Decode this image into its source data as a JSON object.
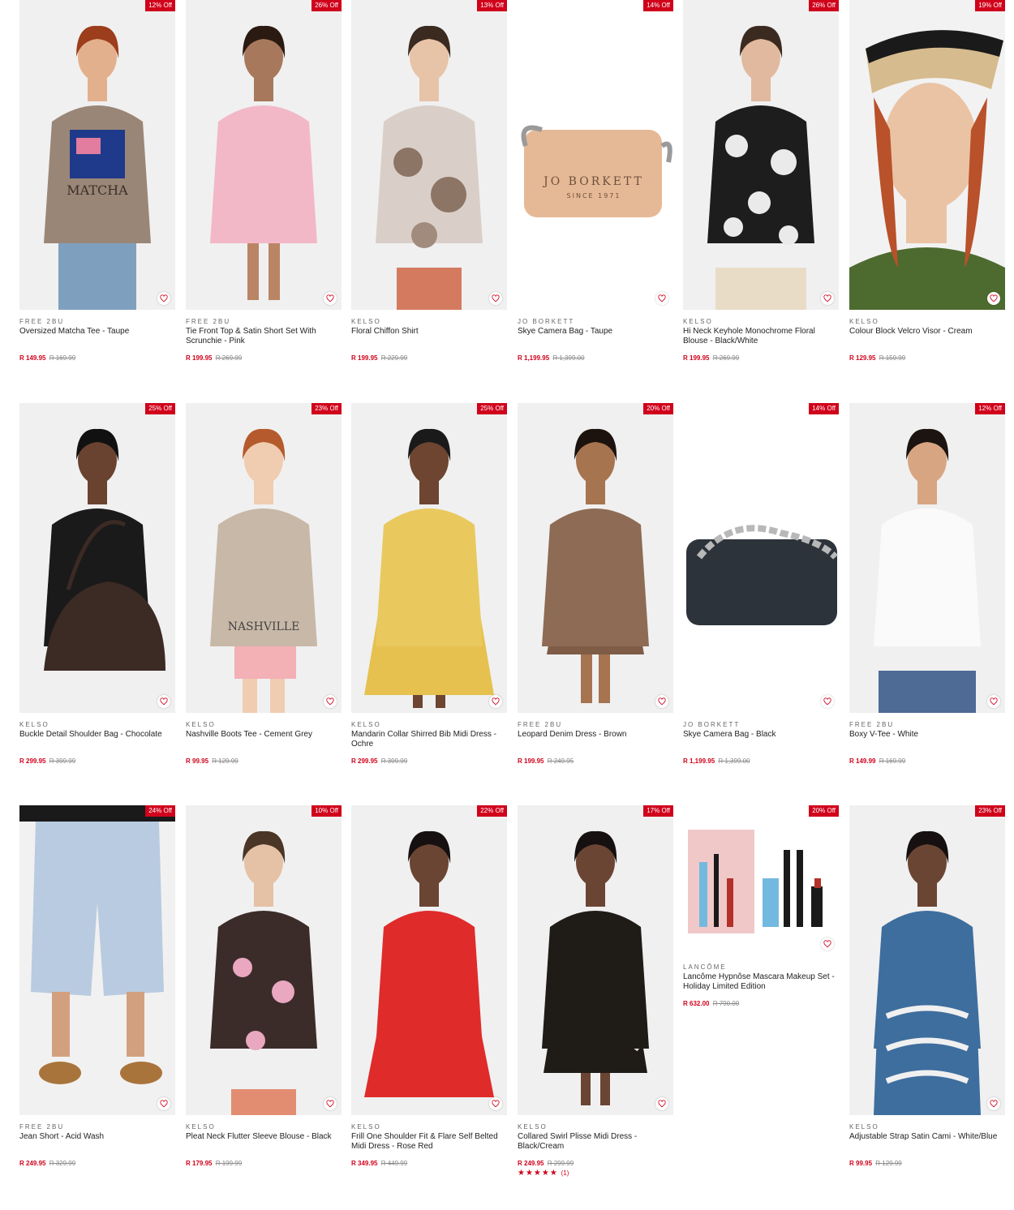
{
  "accent": "#d0021b",
  "products": [
    {
      "badge": "12% Off",
      "brand": "FREE 2BU",
      "name": "Oversized Matcha Tee - Taupe",
      "price": "R 149.95",
      "was": "R 169.99",
      "art": "matcha"
    },
    {
      "badge": "26% Off",
      "brand": "FREE 2BU",
      "name": "Tie Front Top & Satin Short Set With Scrunchie - Pink",
      "price": "R 199.95",
      "was": "R 269.99",
      "art": "pink"
    },
    {
      "badge": "13% Off",
      "brand": "KELSO",
      "name": "Floral Chiffon Shirt",
      "price": "R 199.95",
      "was": "R 229.99",
      "art": "floral"
    },
    {
      "badge": "14% Off",
      "brand": "JO BORKETT",
      "name": "Skye Camera Bag - Taupe",
      "price": "R 1,199.95",
      "was": "R 1,399.00",
      "art": "bag-taupe"
    },
    {
      "badge": "26% Off",
      "brand": "KELSO",
      "name": "Hi Neck Keyhole Monochrome Floral Blouse - Black/White",
      "price": "R 199.95",
      "was": "R 269.99",
      "art": "mono"
    },
    {
      "badge": "19% Off",
      "brand": "KELSO",
      "name": "Colour Block Velcro Visor - Cream",
      "price": "R 129.95",
      "was": "R 159.99",
      "art": "visor"
    },
    {
      "badge": "25% Off",
      "brand": "KELSO",
      "name": "Buckle Detail Shoulder Bag - Chocolate",
      "price": "R 299.95",
      "was": "R 399.99",
      "art": "shoulder"
    },
    {
      "badge": "23% Off",
      "brand": "KELSO",
      "name": "Nashville Boots Tee - Cement Grey",
      "price": "R 99.95",
      "was": "R 129.99",
      "art": "nashville"
    },
    {
      "badge": "25% Off",
      "brand": "KELSO",
      "name": "Mandarin Collar Shirred Bib Midi Dress - Ochre",
      "price": "R 299.95",
      "was": "R 399.99",
      "art": "ochre"
    },
    {
      "badge": "20% Off",
      "brand": "FREE 2BU",
      "name": "Leopard Denim Dress - Brown",
      "price": "R 199.95",
      "was": "R 249.95",
      "art": "leopard"
    },
    {
      "badge": "14% Off",
      "brand": "JO BORKETT",
      "name": "Skye Camera Bag - Black",
      "price": "R 1,199.95",
      "was": "R 1,399.00",
      "art": "bag-black"
    },
    {
      "badge": "12% Off",
      "brand": "FREE 2BU",
      "name": "Boxy V-Tee - White",
      "price": "R 149.99",
      "was": "R 169.99",
      "art": "vtee"
    },
    {
      "badge": "24% Off",
      "brand": "FREE 2BU",
      "name": "Jean Short - Acid Wash",
      "price": "R 249.95",
      "was": "R 329.99",
      "art": "jeans"
    },
    {
      "badge": "10% Off",
      "brand": "KELSO",
      "name": "Pleat Neck Flutter Sleeve Blouse - Black",
      "price": "R 179.95",
      "was": "R 199.99",
      "art": "flutter"
    },
    {
      "badge": "22% Off",
      "brand": "KELSO",
      "name": "Frill One Shoulder Fit & Flare Self Belted Midi Dress - Rose Red",
      "price": "R 349.95",
      "was": "R 449.99",
      "art": "red"
    },
    {
      "badge": "17% Off",
      "brand": "KELSO",
      "name": "Collared Swirl Plisse Midi Dress - Black/Cream",
      "price": "R 249.95",
      "was": "R 299.99",
      "art": "swirl",
      "rating": "★★★★★",
      "rating_count": "(1)",
      "rating_value": 5
    },
    {
      "badge": "20% Off",
      "brand": "LANCÔME",
      "name": "Lancôme Hypnôse Mascara Makeup Set - Holiday Limited Edition",
      "price": "R 632.00",
      "was": "R 790.00",
      "art": "lancome"
    },
    {
      "badge": "23% Off",
      "brand": "KELSO",
      "name": "Adjustable Strap Satin Cami - White/Blue",
      "price": "R 99.95",
      "was": "R 129.99",
      "art": "cami"
    }
  ]
}
